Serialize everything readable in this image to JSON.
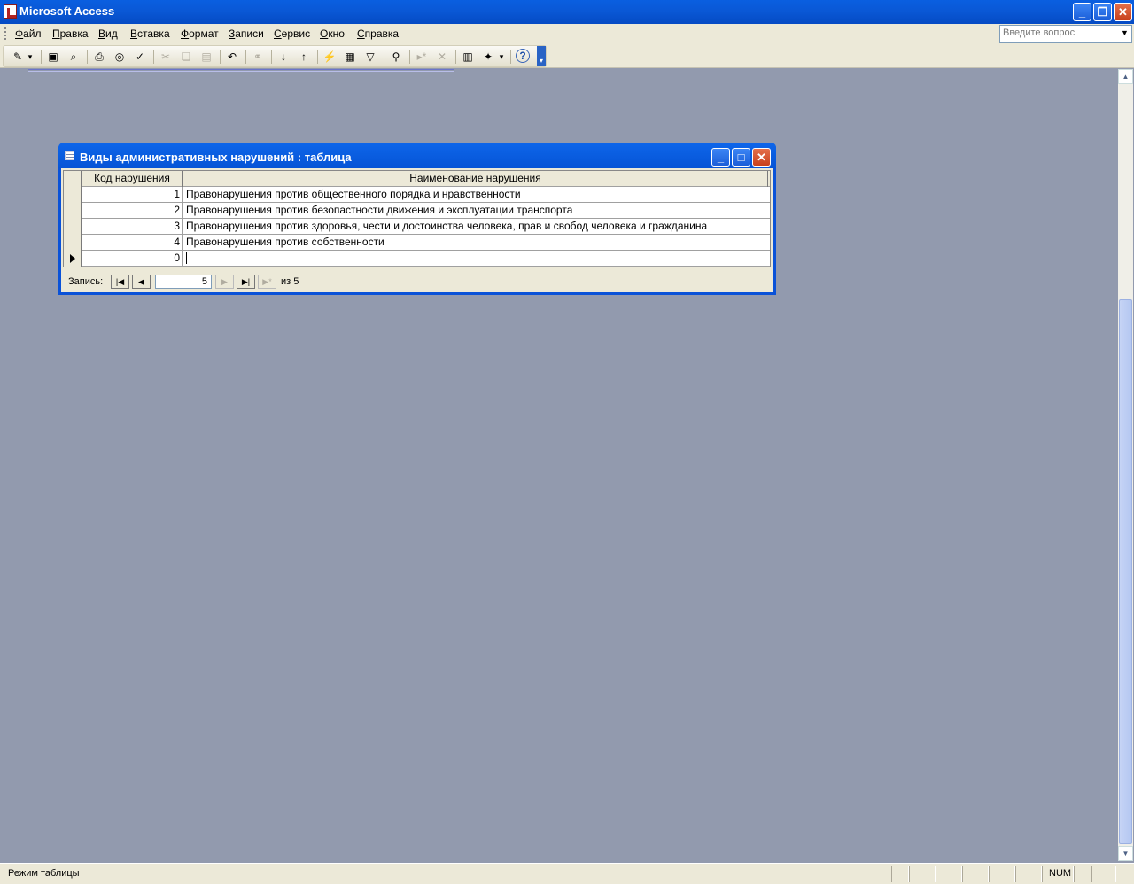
{
  "window": {
    "title": "Microsoft Access",
    "min_glyph": "_",
    "max_glyph": "❐",
    "close_glyph": "✕"
  },
  "menu": {
    "items": [
      {
        "label": "Файл"
      },
      {
        "label": "Правка"
      },
      {
        "label": "Вид"
      },
      {
        "label": "Вставка"
      },
      {
        "label": "Формат"
      },
      {
        "label": "Записи"
      },
      {
        "label": "Сервис"
      },
      {
        "label": "Окно"
      },
      {
        "label": "Справка"
      }
    ],
    "ask_placeholder": "Введите вопрос"
  },
  "toolbar": {
    "buttons": [
      {
        "name": "view-design-icon",
        "glyph": "✎",
        "enabled": true
      },
      {
        "name": "view-dropdown-icon",
        "glyph": "▾",
        "enabled": true
      },
      {
        "name": "save-icon",
        "glyph": "▣",
        "enabled": true
      },
      {
        "name": "file-search-icon",
        "glyph": "⌕",
        "enabled": true
      },
      {
        "name": "print-icon",
        "glyph": "⎙",
        "enabled": true
      },
      {
        "name": "print-preview-icon",
        "glyph": "◎",
        "enabled": true
      },
      {
        "name": "spelling-icon",
        "glyph": "✓",
        "enabled": true
      },
      {
        "name": "cut-icon",
        "glyph": "✂",
        "enabled": false
      },
      {
        "name": "copy-icon",
        "glyph": "❏",
        "enabled": false
      },
      {
        "name": "paste-icon",
        "glyph": "▤",
        "enabled": false
      },
      {
        "name": "undo-icon",
        "glyph": "↶",
        "enabled": true
      },
      {
        "name": "hyperlink-icon",
        "glyph": "⚭",
        "enabled": false
      },
      {
        "name": "sort-ascending-icon",
        "glyph": "↓",
        "enabled": true
      },
      {
        "name": "sort-descending-icon",
        "glyph": "↑",
        "enabled": true
      },
      {
        "name": "filter-by-selection-icon",
        "glyph": "⚡",
        "enabled": true
      },
      {
        "name": "filter-by-form-icon",
        "glyph": "▦",
        "enabled": true
      },
      {
        "name": "apply-filter-icon",
        "glyph": "▽",
        "enabled": true
      },
      {
        "name": "find-icon",
        "glyph": "⚲",
        "enabled": true
      },
      {
        "name": "new-record-icon",
        "glyph": "▸*",
        "enabled": false
      },
      {
        "name": "delete-record-icon",
        "glyph": "✕",
        "enabled": false
      },
      {
        "name": "database-window-icon",
        "glyph": "▥",
        "enabled": true
      },
      {
        "name": "new-object-icon",
        "glyph": "✦",
        "enabled": true
      },
      {
        "name": "new-object-dropdown-icon",
        "glyph": "▾",
        "enabled": true
      },
      {
        "name": "help-icon",
        "glyph": "?",
        "enabled": true
      }
    ]
  },
  "child_window": {
    "title": "Виды административных нарушений : таблица",
    "min_glyph": "_",
    "max_glyph": "□",
    "close_glyph": "✕"
  },
  "datasheet": {
    "columns": [
      "Код нарушения",
      "Наименование нарушения"
    ],
    "rows": [
      {
        "code": "1",
        "name": "Правонарушения против общественного порядка и нравственности"
      },
      {
        "code": "2",
        "name": "Правонарушения против безопастности движения и эксплуатации транспорта"
      },
      {
        "code": "3",
        "name": "Правонарушения против здоровья, чести и достоинства человека, прав и свобод человека и гражданина"
      },
      {
        "code": "4",
        "name": "Правонарушения против собственности"
      },
      {
        "code": "0",
        "name": ""
      }
    ]
  },
  "navigation": {
    "label": "Запись:",
    "current": "5",
    "of_text": "из  5",
    "first_glyph": "|◀",
    "prev_glyph": "◀",
    "next_glyph": "▶",
    "last_glyph": "▶|",
    "new_glyph": "▶*"
  },
  "status": {
    "mode": "Режим таблицы",
    "num": "NUM"
  }
}
